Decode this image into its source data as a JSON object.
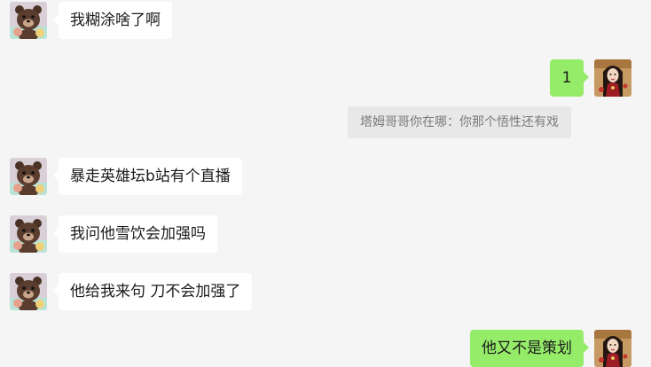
{
  "messages": [
    {
      "side": "left",
      "text": "我糊涂啥了啊"
    },
    {
      "side": "right",
      "text": "1"
    },
    {
      "side": "quote",
      "text": "塔姆哥哥你在哪：你那个悟性还有戏"
    },
    {
      "side": "left",
      "text": "暴走英雄坛b站有个直播"
    },
    {
      "side": "left",
      "text": "我问他雪饮会加强吗"
    },
    {
      "side": "left",
      "text": "他给我来句 刀不会加强了"
    },
    {
      "side": "right",
      "text": "他又不是策划"
    }
  ],
  "colors": {
    "background": "#f5f5f5",
    "incoming_bubble": "#ffffff",
    "outgoing_bubble": "#95ec69",
    "quote_background": "#e8e8e8",
    "quote_text": "#7a7a7a"
  },
  "icons": {
    "left_avatar": "bear-avatar-icon",
    "right_avatar": "red-robed-girl-avatar-icon"
  }
}
